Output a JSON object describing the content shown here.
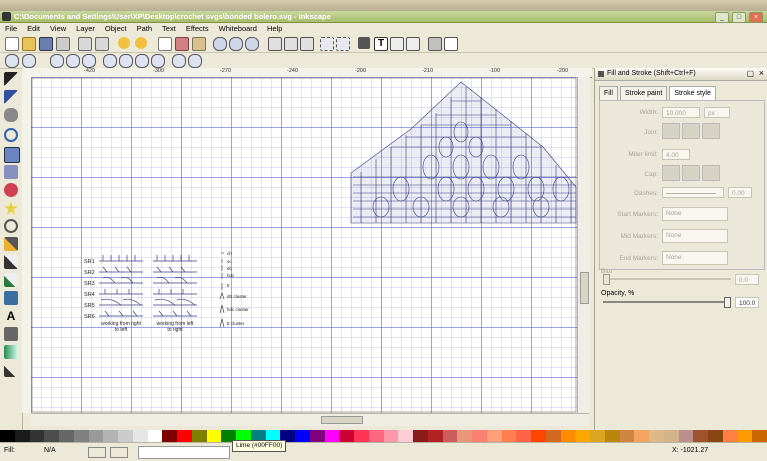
{
  "window": {
    "title": "C:\\Documents and Settings\\User\\XP\\Desktop\\crochet svgs\\bonded bolero.svg - Inkscape"
  },
  "menu": [
    "File",
    "Edit",
    "View",
    "Layer",
    "Object",
    "Path",
    "Text",
    "Effects",
    "Whiteboard",
    "Help"
  ],
  "ruler": {
    "labels": [
      "-420",
      "-300",
      "-270",
      "-240",
      "-200",
      "-210",
      "-100",
      "-200"
    ]
  },
  "canvas": {
    "rows": [
      "SR1",
      "SR2",
      "SR3",
      "SR4",
      "SR5",
      "SR6"
    ],
    "caption_left": [
      "working from right",
      "to left"
    ],
    "caption_right": [
      "working from left",
      "to right"
    ],
    "legend": [
      "ch",
      "sc",
      "dc",
      "hdc",
      "tr",
      "dtr cluster",
      "hdc cluster",
      "tr cluster"
    ]
  },
  "panel": {
    "title": "Fill and Stroke (Shift+Ctrl+F)",
    "tabs": [
      "Fill",
      "Stroke paint",
      "Stroke style"
    ],
    "fields": [
      {
        "label": "Width:",
        "value": "10.000",
        "unit": "px"
      },
      {
        "label": "Join:",
        "value": ""
      },
      {
        "label": "Miter limit:",
        "value": "4.00"
      },
      {
        "label": "Cap:",
        "value": ""
      },
      {
        "label": "Dashes:",
        "value": "0.00"
      },
      {
        "label": "Start Markers:",
        "value": "None"
      },
      {
        "label": "Mid Markers:",
        "value": "None"
      },
      {
        "label": "End Markers:",
        "value": "None"
      }
    ],
    "blur_label": "Blur",
    "blur_value": "0.0",
    "opacity_label": "Opacity, %",
    "opacity_value": "100.0"
  },
  "status": {
    "fill_label": "Fill:",
    "fill_value": "N/A",
    "tooltip": "Lime (#00FF00)",
    "coords": "X: -1021.27"
  },
  "palette": [
    "#000000",
    "#1a1a1a",
    "#333333",
    "#4d4d4d",
    "#666666",
    "#808080",
    "#999999",
    "#b3b3b3",
    "#cccccc",
    "#e6e6e6",
    "#ffffff",
    "#800000",
    "#ff0000",
    "#808000",
    "#ffff00",
    "#008000",
    "#00ff00",
    "#008080",
    "#00ffff",
    "#000080",
    "#0000ff",
    "#800080",
    "#ff00ff",
    "#cc0033",
    "#ff3355",
    "#ff6680",
    "#ff99aa",
    "#ffccd5",
    "#8b1a1a",
    "#b22222",
    "#cd5c5c",
    "#e9967a",
    "#fa8072",
    "#ffa07a",
    "#ff7f50",
    "#ff6347",
    "#ff4500",
    "#d2691e",
    "#ff8c00",
    "#ffa500",
    "#daa520",
    "#b8860b",
    "#cd853f",
    "#f4a460",
    "#deb887",
    "#d2b48c",
    "#bc8f8f",
    "#a0522d",
    "#8b4513",
    "#ff8040",
    "#ff9900",
    "#cc6600"
  ]
}
